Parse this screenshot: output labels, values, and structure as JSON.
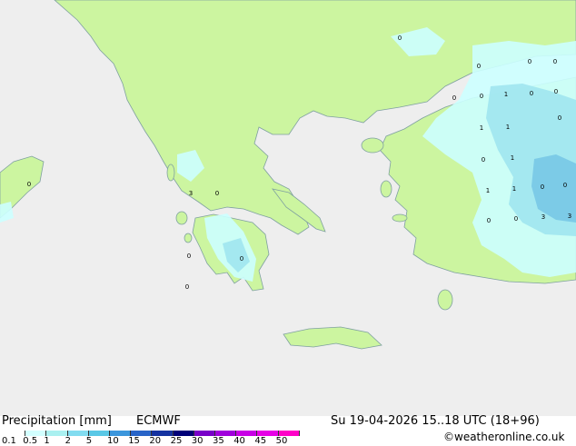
{
  "map": {
    "background_color": "#eeeeee",
    "land_color": "#ccf5a0",
    "coast_color": "#7fa0a0",
    "precip_colors": [
      "#ccffff",
      "#a0e6f0",
      "#78c8e6"
    ],
    "point_values": [
      "0",
      "0",
      "0",
      "0",
      "0",
      "0",
      "1",
      "0",
      "0",
      "1",
      "1",
      "0",
      "1",
      "1",
      "1",
      "0",
      "0",
      "0",
      "0",
      "3",
      "3",
      "0",
      "3",
      "0",
      "0",
      "0",
      "0",
      "0"
    ]
  },
  "footer": {
    "title": "Precipitation [mm]",
    "model": "ECMWF",
    "datetime": "Su 19-04-2026 15..18 UTC (18+96)",
    "credit": "©weatheronline.co.uk",
    "scale_ticks": [
      "0.1",
      "0.5",
      "1",
      "2",
      "5",
      "10",
      "15",
      "20",
      "25",
      "30",
      "35",
      "40",
      "45",
      "50"
    ],
    "scale_colors": [
      "#ffffff",
      "#d2ffff",
      "#aaf0f0",
      "#82dcf0",
      "#5ac8e6",
      "#3c96dc",
      "#2864c8",
      "#1432a0",
      "#000078",
      "#7800c8",
      "#a000dc",
      "#c800e6",
      "#e600e6",
      "#ff00c8"
    ]
  }
}
